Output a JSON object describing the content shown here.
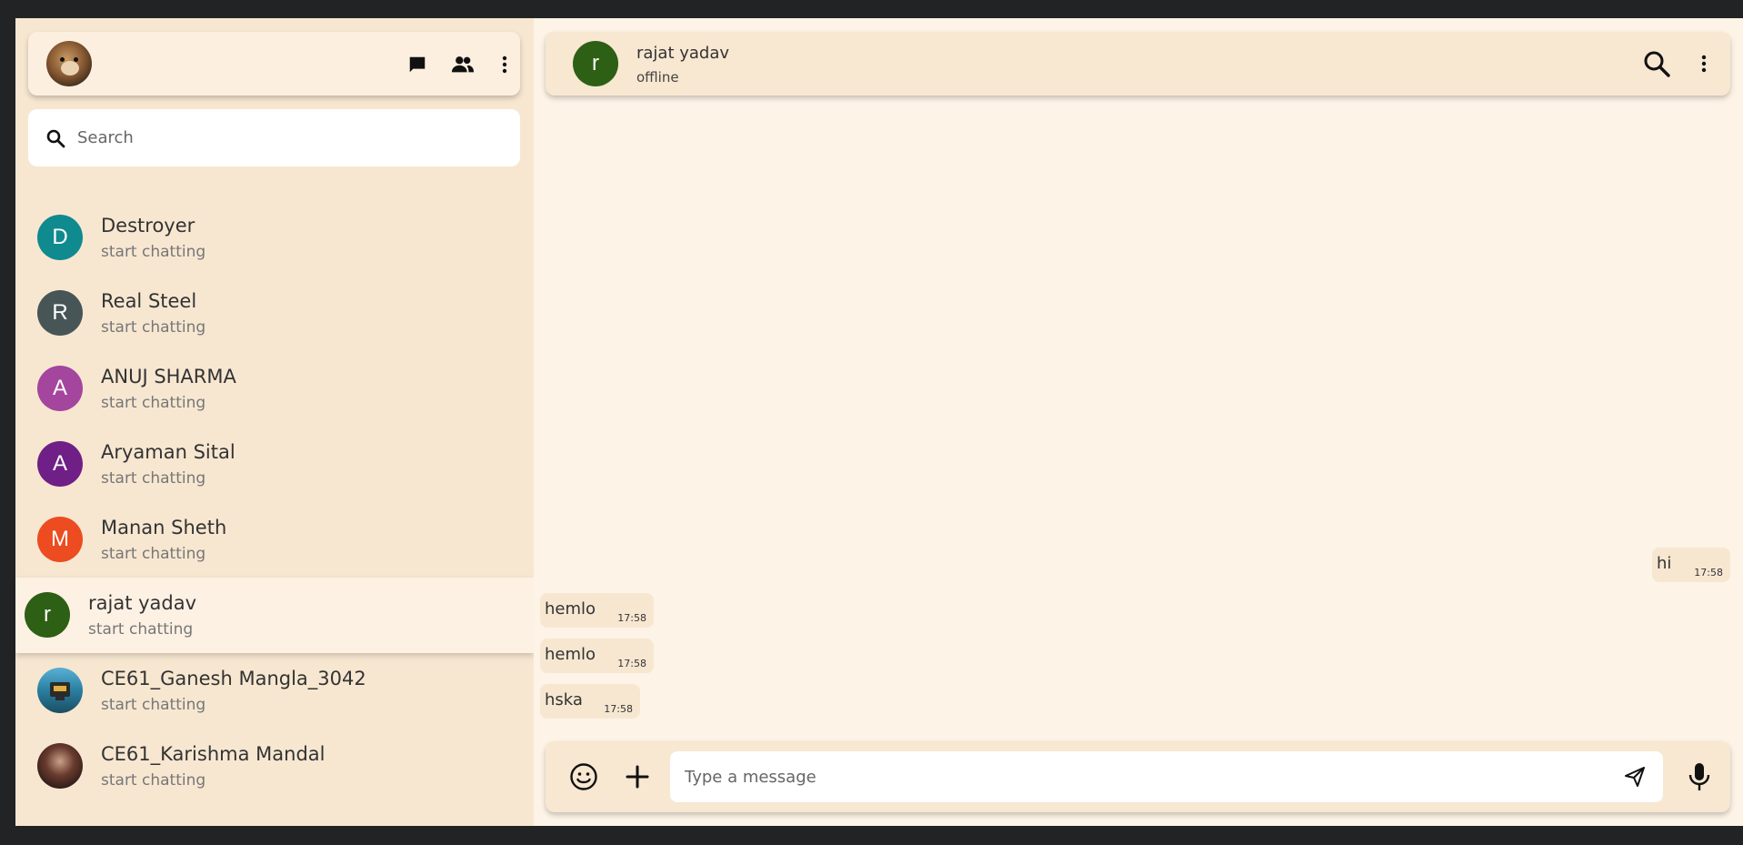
{
  "sidebar": {
    "search_placeholder": "Search",
    "contacts": [
      {
        "name": "Destroyer",
        "preview": "start chatting",
        "initial": "D",
        "color": "#0f8a8f"
      },
      {
        "name": "Real Steel",
        "preview": "start chatting",
        "initial": "R",
        "color": "#475557"
      },
      {
        "name": "ANUJ SHARMA",
        "preview": "start chatting",
        "initial": "A",
        "color": "#a4459e"
      },
      {
        "name": "Aryaman Sital",
        "preview": "start chatting",
        "initial": "A",
        "color": "#6f1f86"
      },
      {
        "name": "Manan Sheth",
        "preview": "start chatting",
        "initial": "M",
        "color": "#ec4c1f"
      },
      {
        "name": "rajat yadav",
        "preview": "start chatting",
        "initial": "r",
        "color": "#2d5f15",
        "active": true
      },
      {
        "name": "CE61_Ganesh Mangla_3042",
        "preview": "start chatting",
        "initial": "",
        "color": "#2a7fa0"
      },
      {
        "name": "CE61_Karishma Mandal",
        "preview": "start chatting",
        "initial": "",
        "color": "#4a2b22"
      }
    ]
  },
  "chat": {
    "contact_name": "rajat yadav",
    "contact_status": "offline",
    "contact_initial": "r",
    "messages": [
      {
        "text": "hi",
        "time": "17:58",
        "side": "right"
      },
      {
        "text": "hemlo",
        "time": "17:58",
        "side": "left"
      },
      {
        "text": "hemlo",
        "time": "17:58",
        "side": "left"
      },
      {
        "text": "hska",
        "time": "17:58",
        "side": "left"
      }
    ],
    "composer_placeholder": "Type a message"
  },
  "icons": {
    "chat": "chat-icon",
    "group": "group-icon",
    "menu": "more-vertical-icon",
    "search": "search-icon",
    "emoji": "emoji-icon",
    "attach": "plus-icon",
    "send": "send-icon",
    "mic": "mic-icon"
  },
  "colors": {
    "sidebar_bg": "#f7e7d1",
    "chat_bg": "#fdf3e6",
    "bubble_bg": "#f7e7d1"
  }
}
